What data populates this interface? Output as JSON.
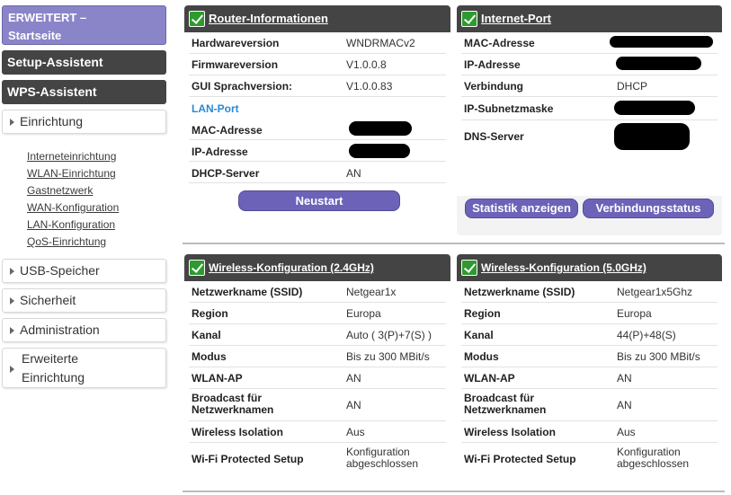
{
  "sidebar": {
    "top_label_1": "ERWEITERT –",
    "top_label_2": "Startseite",
    "setup_assistant": "Setup-Assistent",
    "wps_assistant": "WPS-Assistent",
    "einrichtung": "Einrichtung",
    "sub_links": [
      "Interneteinrichtung",
      "WLAN-Einrichtung",
      "Gastnetzwerk",
      "WAN-Konfiguration",
      "LAN-Konfiguration",
      "QoS-Einrichtung"
    ],
    "usb": "USB-Speicher",
    "security": "Sicherheit",
    "administration": "Administration",
    "advanced_1": "Erweiterte",
    "advanced_2": "Einrichtung"
  },
  "router_info": {
    "title": "Router-Informationen",
    "rows": [
      {
        "label": "Hardwareversion",
        "value": "WNDRMACv2"
      },
      {
        "label": "Firmwareversion",
        "value": "V1.0.0.8"
      },
      {
        "label": "GUI Sprachversion:",
        "value": "V1.0.0.83"
      }
    ],
    "lan_port": "LAN-Port",
    "lan_rows": [
      {
        "label": "MAC-Adresse",
        "value": ""
      },
      {
        "label": "IP-Adresse",
        "value": ""
      },
      {
        "label": "DHCP-Server",
        "value": "AN"
      }
    ],
    "restart_button": "Neustart"
  },
  "internet_port": {
    "title": "Internet-Port",
    "rows": [
      {
        "label": "MAC-Adresse",
        "value": ""
      },
      {
        "label": "IP-Adresse",
        "value": ""
      },
      {
        "label": "Verbindung",
        "value": "DHCP"
      },
      {
        "label": "IP-Subnetzmaske",
        "value": ""
      },
      {
        "label": "DNS-Server",
        "value": ""
      }
    ],
    "stats_button": "Statistik anzeigen",
    "status_button": "Verbindungsstatus"
  },
  "wireless_24": {
    "title": "Wireless-Konfiguration (2.4GHz)",
    "rows": [
      {
        "label": "Netzwerkname (SSID)",
        "value": "Netgear1x"
      },
      {
        "label": "Region",
        "value": "Europa"
      },
      {
        "label": "Kanal",
        "value": "Auto ( 3(P)+7(S) )"
      },
      {
        "label": "Modus",
        "value": "Bis zu 300 MBit/s"
      },
      {
        "label": "WLAN-AP",
        "value": "AN"
      },
      {
        "label": "Broadcast für Netzwerknamen",
        "value": "AN"
      },
      {
        "label": "Wireless Isolation",
        "value": "Aus"
      },
      {
        "label": "Wi-Fi Protected Setup",
        "value": "Konfiguration abgeschlossen"
      }
    ]
  },
  "wireless_50": {
    "title": "Wireless-Konfiguration (5.0GHz)",
    "rows": [
      {
        "label": "Netzwerkname (SSID)",
        "value": "Netgear1x5Ghz"
      },
      {
        "label": "Region",
        "value": "Europa"
      },
      {
        "label": "Kanal",
        "value": "44(P)+48(S)"
      },
      {
        "label": "Modus",
        "value": "Bis zu 300 MBit/s"
      },
      {
        "label": "WLAN-AP",
        "value": "AN"
      },
      {
        "label": "Broadcast für Netzwerknamen",
        "value": "AN"
      },
      {
        "label": "Wireless Isolation",
        "value": "Aus"
      },
      {
        "label": "Wi-Fi Protected Setup",
        "value": "Konfiguration abgeschlossen"
      }
    ]
  },
  "colors": {
    "accent_purple": "#8a84c8",
    "button_purple": "#6c63b8",
    "header_dark": "#444444",
    "check_green": "#2f9a2f",
    "lan_link_blue": "#2a8ad4"
  }
}
